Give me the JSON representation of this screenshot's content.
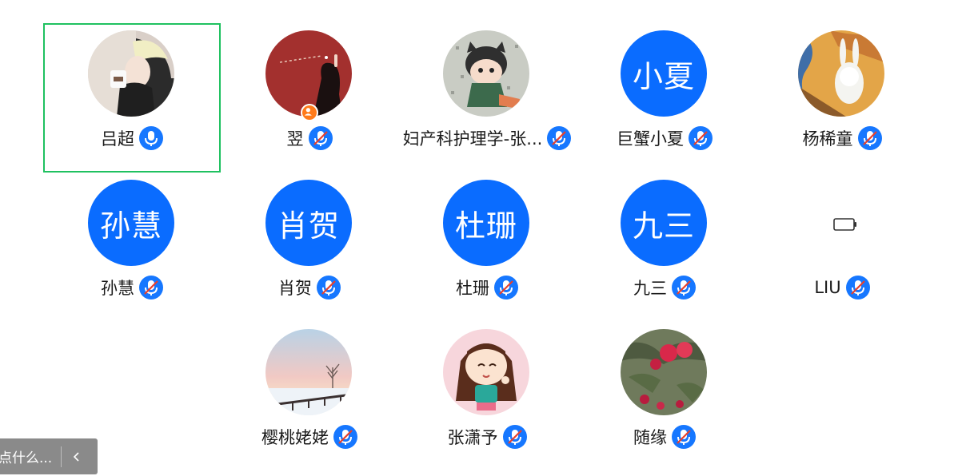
{
  "participants": [
    {
      "name": "吕超",
      "avatar_text": "",
      "avatar_kind": "photo-girl-hat",
      "mic": "on",
      "speaking": true,
      "host": false
    },
    {
      "name": "翌",
      "avatar_text": "",
      "avatar_kind": "photo-red",
      "mic": "off",
      "speaking": false,
      "host": true
    },
    {
      "name": "妇产科护理学-张...",
      "avatar_text": "",
      "avatar_kind": "cartoon-cat-boy",
      "mic": "off",
      "speaking": false,
      "host": false
    },
    {
      "name": "巨蟹小夏",
      "avatar_text": "小夏",
      "avatar_kind": "text",
      "mic": "off",
      "speaking": false,
      "host": false
    },
    {
      "name": "杨稀童",
      "avatar_text": "",
      "avatar_kind": "painting-scream-rabbit",
      "mic": "off",
      "speaking": false,
      "host": false
    },
    {
      "name": "孙慧",
      "avatar_text": "孙慧",
      "avatar_kind": "text",
      "mic": "off",
      "speaking": false,
      "host": false
    },
    {
      "name": "肖贺",
      "avatar_text": "肖贺",
      "avatar_kind": "text",
      "mic": "off",
      "speaking": false,
      "host": false
    },
    {
      "name": "杜珊",
      "avatar_text": "杜珊",
      "avatar_kind": "text",
      "mic": "off",
      "speaking": false,
      "host": false
    },
    {
      "name": "九三",
      "avatar_text": "九三",
      "avatar_kind": "text",
      "mic": "off",
      "speaking": false,
      "host": false
    },
    {
      "name": "LIU",
      "avatar_text": "",
      "avatar_kind": "battery-icon",
      "mic": "off",
      "speaking": false,
      "host": false
    },
    {
      "name": "樱桃姥姥",
      "avatar_text": "",
      "avatar_kind": "photo-snow-sunset",
      "mic": "off",
      "speaking": false,
      "host": false
    },
    {
      "name": "张潇予",
      "avatar_text": "",
      "avatar_kind": "cartoon-girl",
      "mic": "off",
      "speaking": false,
      "host": false
    },
    {
      "name": "随缘",
      "avatar_text": "",
      "avatar_kind": "photo-apples",
      "mic": "off",
      "speaking": false,
      "host": false
    }
  ],
  "chat": {
    "placeholder": "点什么...",
    "collapse_icon": "chevron-left-icon"
  },
  "colors": {
    "avatar_blue": "#0a6cff",
    "mic_blue": "#1677ff",
    "mute_red": "#e8402c",
    "speaking_border": "#1fc160",
    "host_badge": "#ff7a1a"
  }
}
